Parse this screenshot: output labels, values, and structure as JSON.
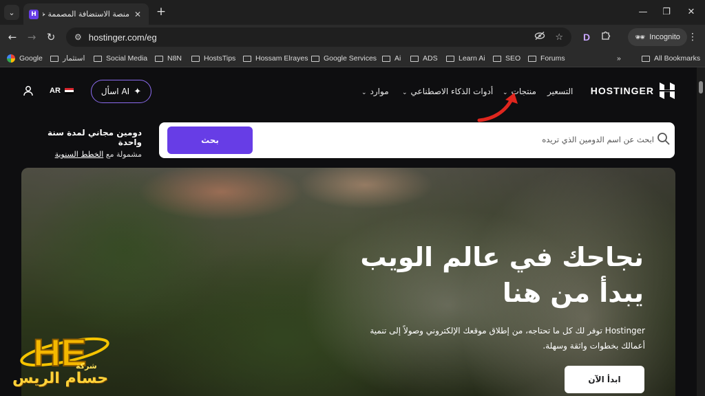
{
  "browser": {
    "tab_title": "منصة الاستضافة المصممة خصيصاً",
    "favicon_letter": "H",
    "url": "hostinger.com/eg",
    "incognito_label": "Incognito",
    "extension_letter": "D",
    "bookmarks": [
      "Google",
      "استثمار",
      "Social Media",
      "N8N",
      "HostsTips",
      "Hossam Elrayes",
      "Google Services",
      "Ai",
      "ADS",
      "Learn Ai",
      "SEO",
      "Forums"
    ],
    "more_bookmarks": "»",
    "all_bookmarks": "All Bookmarks"
  },
  "header": {
    "logo_text": "HOSTINGER",
    "nav": {
      "pricing": "التسعير",
      "products": "منتجات",
      "ai_tools": "أدوات الذكاء الاصطناعي",
      "resources": "موارد"
    },
    "ask_ai": "اسأل AI",
    "lang": "AR"
  },
  "search": {
    "placeholder": "ابحث عن اسم الدومين الذي تريده",
    "button": "بحث"
  },
  "domain_offer": {
    "line1": "دومين مجاني لمدة سنة واحدة",
    "line2_prefix": "مشمولة مع ",
    "line2_link": "الخطط السنوية"
  },
  "hero": {
    "title_line1": "نجاحك في عالم الويب",
    "title_line2": "يبدأ من هنا",
    "subtitle": "Hostinger توفر لك كل ما تحتاجه، من إطلاق موقعك الإلكتروني وصولاً إلى تنمية أعمالك بخطوات واثقة وسهلة.",
    "cta": "ابدأ الآن"
  },
  "watermark": {
    "logo_letters": "HE",
    "small": "شركة",
    "name": "حسام الريس"
  },
  "colors": {
    "brand_purple": "#673de6",
    "page_bg": "#0e0e10",
    "arrow_red": "#e0261e"
  }
}
